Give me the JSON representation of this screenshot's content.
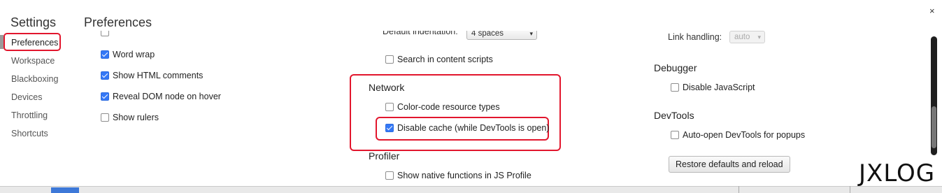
{
  "sidebar": {
    "title": "Settings",
    "items": [
      {
        "label": "Preferences"
      },
      {
        "label": "Workspace"
      },
      {
        "label": "Blackboxing"
      },
      {
        "label": "Devices"
      },
      {
        "label": "Throttling"
      },
      {
        "label": "Shortcuts"
      }
    ]
  },
  "main": {
    "title": "Preferences",
    "close": "×"
  },
  "col1": {
    "items": [
      {
        "label": "Word wrap",
        "checked": true
      },
      {
        "label": "Show HTML comments",
        "checked": true
      },
      {
        "label": "Reveal DOM node on hover",
        "checked": true
      },
      {
        "label": "Show rulers",
        "checked": false
      }
    ]
  },
  "col2": {
    "indentation_label": "Default indentation:",
    "indentation_value": "4 spaces",
    "search_content_scripts": {
      "label": "Search in content scripts",
      "checked": false
    },
    "network": {
      "title": "Network",
      "color_code": {
        "label": "Color-code resource types",
        "checked": false
      },
      "disable_cache": {
        "label": "Disable cache (while DevTools is open)",
        "checked": true
      }
    },
    "profiler": {
      "title": "Profiler",
      "native_functions": {
        "label": "Show native functions in JS Profile",
        "checked": false
      }
    }
  },
  "col3": {
    "link_handling_label": "Link handling:",
    "link_handling_value": "auto",
    "debugger": {
      "title": "Debugger",
      "disable_js": {
        "label": "Disable JavaScript",
        "checked": false
      }
    },
    "devtools": {
      "title": "DevTools",
      "auto_open": {
        "label": "Auto-open DevTools for popups",
        "checked": false
      }
    },
    "restore_button": "Restore defaults and reload"
  },
  "watermark": "JXLOG",
  "colors": {
    "highlight": "#e2162d",
    "checkbox_checked": "#3478f6"
  }
}
